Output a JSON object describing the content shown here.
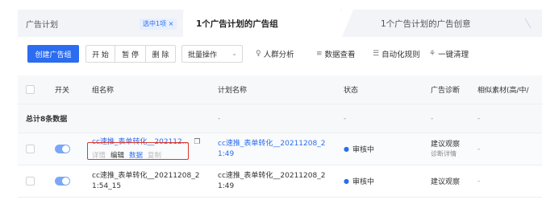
{
  "tabs": {
    "plan": "广告计划",
    "selected_badge": "选中1项 ×",
    "groups": "1个广告计划的广告组",
    "creatives": "1个广告计划的广告创意"
  },
  "toolbar": {
    "create": "创建广告组",
    "start": "开 始",
    "pause": "暂 停",
    "delete": "删 除",
    "batch": "批量操作",
    "audience": "人群分析",
    "data_view": "数据查看",
    "auto_rules": "自动化规则",
    "clean": "一键清理"
  },
  "table": {
    "headers": {
      "switch": "开关",
      "group_name": "组名称",
      "plan_name": "计划名称",
      "status": "状态",
      "diagnosis": "广告诊断",
      "similar": "相似素材(高/中/"
    },
    "total_label": "总计8条数据",
    "total_dash": "-",
    "rows": [
      {
        "group_name": "cc速推_表单转化__202112...",
        "actions": {
          "detail": "详情",
          "edit": "编辑",
          "data": "数据",
          "copy": "复制"
        },
        "plan_name_1": "cc速推_表单转化__20211208_2",
        "plan_name_2": "1:49",
        "status": "审核中",
        "diagnosis": "建议观察",
        "diagnosis_sub": "诊断详情",
        "similar": "-"
      },
      {
        "group_name_1": "cc速推_表单转化__20211208_2",
        "group_name_2": "1:54_15",
        "plan_name_1": "cc速推_表单转化__20211208_2",
        "plan_name_2": "1:49",
        "status": "审核中",
        "diagnosis": "建议观察",
        "similar": "-"
      }
    ]
  },
  "colors": {
    "accent": "#2b6cf0",
    "highlight": "#e0352b"
  }
}
